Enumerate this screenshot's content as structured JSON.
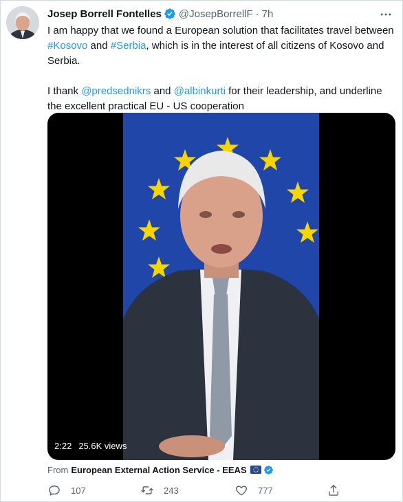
{
  "tweet": {
    "author_name": "Josep Borrell Fontelles",
    "handle": "@JosepBorrellF",
    "separator": "·",
    "time": "7h",
    "paragraph1": {
      "t1": "I am happy that we found a European solution that facilitates travel between ",
      "hashtag1": "#Kosovo",
      "t2": " and ",
      "hashtag2": "#Serbia",
      "t3": ", which is in the interest of all citizens of Kosovo and Serbia."
    },
    "paragraph2": {
      "t1": "I thank ",
      "mention1": "@predsednikrs",
      "t2": " and ",
      "mention2": "@albinkurti",
      "t3": " for their leadership, and underline the excellent practical EU - US cooperation"
    },
    "media": {
      "duration": "2:22",
      "views": "25.6K views"
    },
    "source": {
      "prefix": "From",
      "name": "European External Action Service - EEAS"
    },
    "actions": {
      "replies": "107",
      "retweets": "243",
      "likes": "777"
    }
  },
  "colors": {
    "link": "#1d9bf0",
    "verified": "#1d9bf0",
    "eu_blue": "#1f46a8",
    "eu_star": "#f6d500",
    "secondary_text": "#536471"
  },
  "icons": {
    "verified": "verified-badge-icon",
    "more": "more-icon",
    "reply": "reply-icon",
    "retweet": "retweet-icon",
    "like": "like-icon",
    "share": "share-icon",
    "eu_flag": "eu-flag-icon"
  }
}
